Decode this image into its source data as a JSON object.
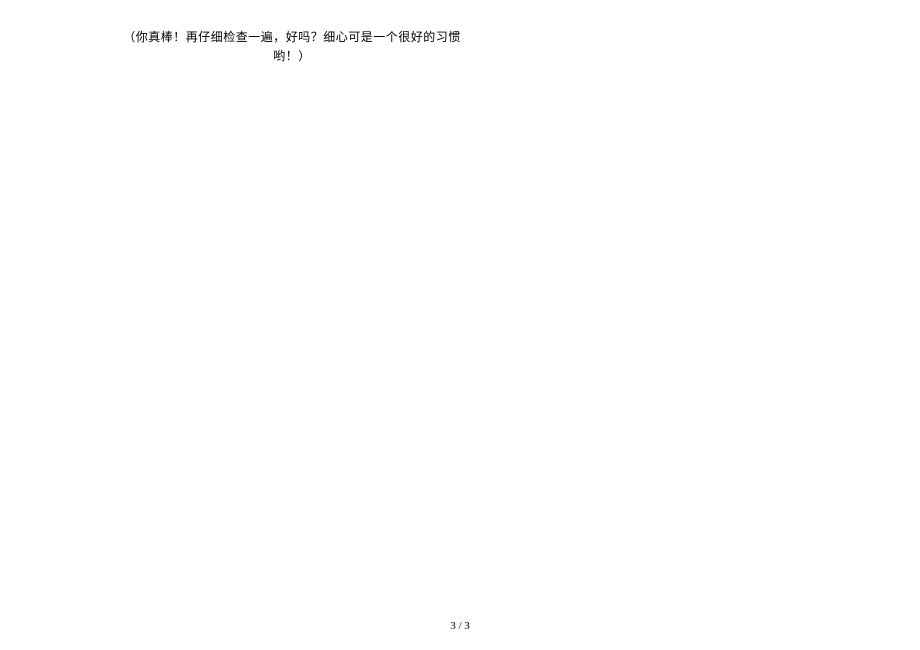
{
  "paragraph": {
    "line1": "（你真棒！再仔细检查一遍，好吗？细心可是一个很好的习惯",
    "line2": "哟！）"
  },
  "footer": {
    "page_number": "3 / 3"
  }
}
